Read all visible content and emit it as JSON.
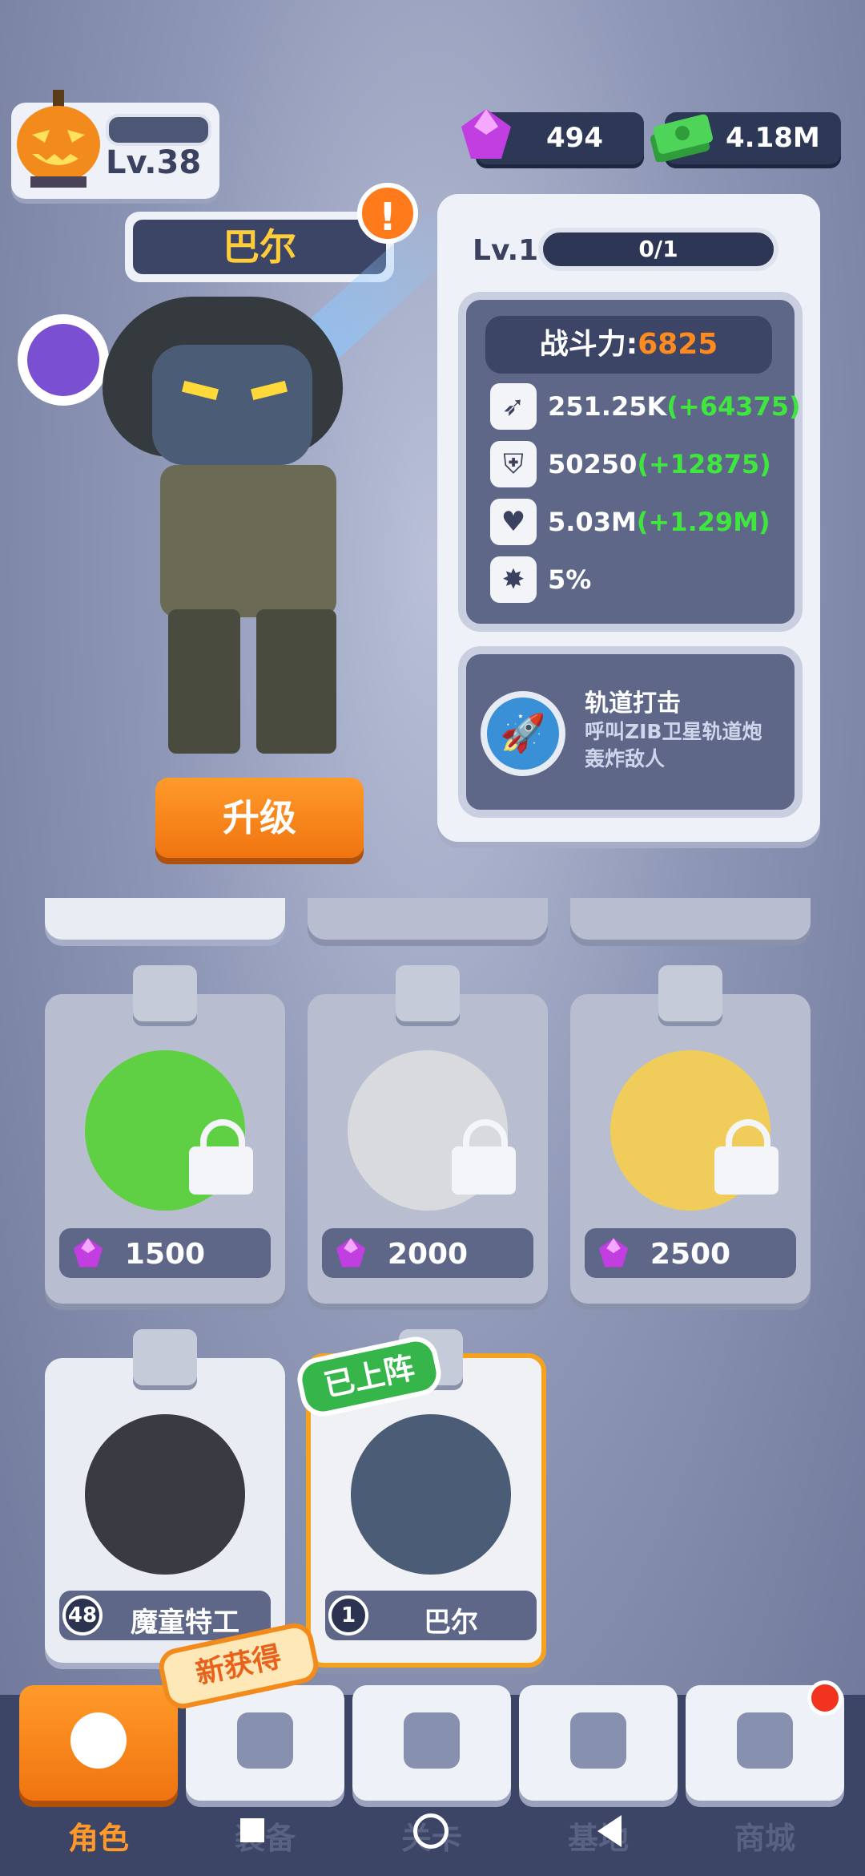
{
  "player": {
    "level": "Lv.38"
  },
  "currency": {
    "gems": "494",
    "cash": "4.18M"
  },
  "hero": {
    "name": "巴尔",
    "alert": "!",
    "level": "Lv.1",
    "progress": "0/1",
    "power_label": "战斗力:",
    "power_value": "6825",
    "stats": [
      {
        "icon": "attack-icon",
        "value": "251.25K",
        "bonus": "(+64375)"
      },
      {
        "icon": "armor-icon",
        "value": "50250",
        "bonus": "(+12875)"
      },
      {
        "icon": "health-icon",
        "value": "5.03M",
        "bonus": "(+1.29M)"
      },
      {
        "icon": "crit-icon",
        "value": "5%",
        "bonus": ""
      }
    ],
    "skill_name": "轨道打击",
    "skill_desc": "呼叫ZIB卫星轨道炮轰炸敌人",
    "upgrade_label": "升级"
  },
  "cards": [
    {
      "price": "1500",
      "locked": true
    },
    {
      "price": "2000",
      "locked": true
    },
    {
      "price": "2500",
      "locked": true
    },
    {
      "level": "48",
      "name": "魔童特工"
    },
    {
      "level": "1",
      "name": "巴尔",
      "tag": "已上阵"
    }
  ],
  "new_tag": "新获得",
  "nav": [
    {
      "label": "角色",
      "active": true
    },
    {
      "label": "装备"
    },
    {
      "label": "关卡"
    },
    {
      "label": "基地"
    },
    {
      "label": "商城"
    }
  ],
  "colors": {
    "accent": "#ff8a1f",
    "bonus": "#3ee63e",
    "gem": "#c13ee0"
  }
}
